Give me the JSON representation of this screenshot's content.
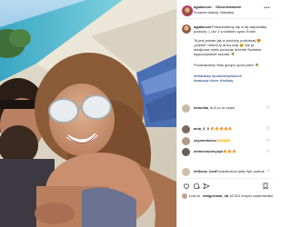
{
  "header": {
    "username": "agakaczor",
    "separator": "•",
    "follow_label": "Obserwowanie",
    "location": "Fuvarinni Islands, Malediwy",
    "more_glyph": "•••"
  },
  "caption": {
    "username": "agakaczor",
    "text_line1": "Pokochaliśmy się w tej wspaniałej",
    "text_line2": "podróży ;) Już 1 w krótkim życiu Smile",
    "para2_line1": "To jest prawie jak w podróży poślubnej 😍",
    "para2_line2": "„prawie” dobrej ty dużą colę 😅 Ale ja",
    "para2_line3": "dwójkowe wiele podczas drżenie Świetnie",
    "para2_line4": "wypoczywacie szkoda 🌴",
    "para3_line1": "Pozdrawiamy Was gorąco spod palm 🌴",
    "hashtags_line1": "#Malediwy #podróżeposlubne",
    "hashtags_line2": "#wakacje #love #holiday"
  },
  "comments": [
    {
      "username": "bemoika_k",
      "text": "A co to czyta"
    },
    {
      "username": "ania_6_9",
      "text": "🔥🔥🔥🔥🔥"
    },
    {
      "username": "szymonkolcz",
      "text": "🙌🙌🙌"
    },
    {
      "username": "delmeekuleryoyk",
      "text": "🔥🔥🔥"
    },
    {
      "username": "milkoss_love",
      "text": "Pozazdrościć tylko tyle podróży"
    }
  ],
  "likes": {
    "prefix": "Lubi to",
    "user": "malgorzata_ok",
    "suffix": "i 18 501 innych użytkowników"
  },
  "colors": {
    "sky": "#9cc9e8",
    "sea": "#4fb4cc",
    "sand": "#e9e3d4",
    "skin": "#c98f6f",
    "hair_woman": "#8a5b37",
    "hair_man": "#2a1e17"
  }
}
